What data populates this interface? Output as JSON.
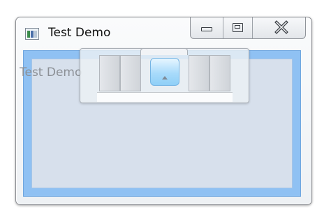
{
  "window": {
    "title": "Test Demo",
    "app_icon": "app-icon",
    "caption_buttons": {
      "minimize_icon": "minimize-icon",
      "maximize_icon": "maximize-icon",
      "close_icon": "close-icon"
    }
  },
  "content": {
    "text": "Test Demo"
  },
  "snap_overlay": {
    "center_icon": "arrow-up-icon"
  },
  "colors": {
    "client_border": "#8fc1f3",
    "client_fill": "#d7e0ec",
    "overlay_center": "#a9dbfb"
  }
}
